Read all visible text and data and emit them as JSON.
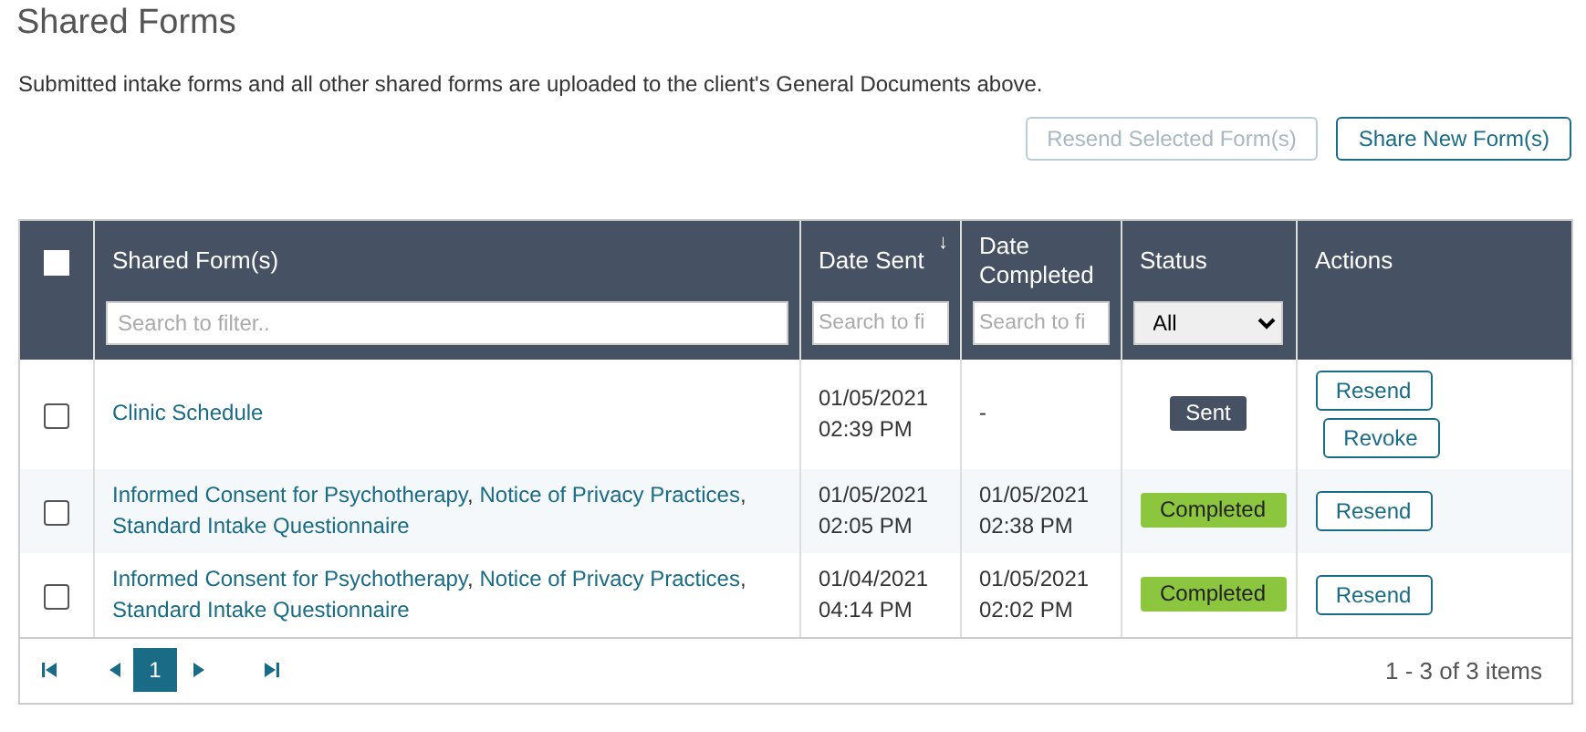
{
  "title": "Shared Forms",
  "description": "Submitted intake forms and all other shared forms are uploaded to the client's General Documents above.",
  "buttons": [
    {
      "label": "Resend Selected Form(s)",
      "disabled": true
    },
    {
      "label": "Share New Form(s)",
      "disabled": false
    }
  ],
  "table": {
    "select_all": {
      "checked": false
    },
    "columns": [
      {
        "label": "Shared Form(s)",
        "filter": {
          "kind": "text",
          "placeholder": "Search to filter.."
        }
      },
      {
        "label": "Date Sent",
        "sort_indicator": "↓",
        "filter": {
          "kind": "text",
          "placeholder": "Search to fi"
        }
      },
      {
        "label": "Date Completed",
        "filter": {
          "kind": "text",
          "placeholder": "Search to fi"
        }
      },
      {
        "label": "Status",
        "filter": {
          "kind": "select",
          "value": "All"
        }
      },
      {
        "label": "Actions"
      }
    ],
    "rows": [
      {
        "checked": false,
        "forms": [
          {
            "name": "Clinic Schedule"
          }
        ],
        "date_sent": [
          "01/05/2021",
          "02:39 PM"
        ],
        "date_completed": [
          "-"
        ],
        "status": {
          "label": "Sent",
          "kind": "sent"
        },
        "actions": [
          "Resend",
          "Revoke"
        ]
      },
      {
        "checked": false,
        "forms": [
          {
            "name": "Informed Consent for Psychotherapy",
            "separator": ","
          },
          {
            "name": "Notice of Privacy Practices",
            "separator": ","
          },
          {
            "name": "Standard Intake Questionnaire"
          }
        ],
        "date_sent": [
          "01/05/2021",
          "02:05 PM"
        ],
        "date_completed": [
          "01/05/2021",
          "02:38 PM"
        ],
        "status": {
          "label": "Completed",
          "kind": "completed"
        },
        "actions": [
          "Resend"
        ]
      },
      {
        "checked": false,
        "forms": [
          {
            "name": "Informed Consent for Psychotherapy",
            "separator": ","
          },
          {
            "name": "Notice of Privacy Practices",
            "separator": ","
          },
          {
            "name": "Standard Intake Questionnaire"
          }
        ],
        "date_sent": [
          "01/04/2021",
          "04:14 PM"
        ],
        "date_completed": [
          "01/05/2021",
          "02:02 PM"
        ],
        "status": {
          "label": "Completed",
          "kind": "completed"
        },
        "actions": [
          "Resend"
        ]
      }
    ]
  },
  "pager": {
    "pages": [
      {
        "label": "1",
        "selected": true
      }
    ],
    "summary": "1 - 3 of 3 items"
  }
}
